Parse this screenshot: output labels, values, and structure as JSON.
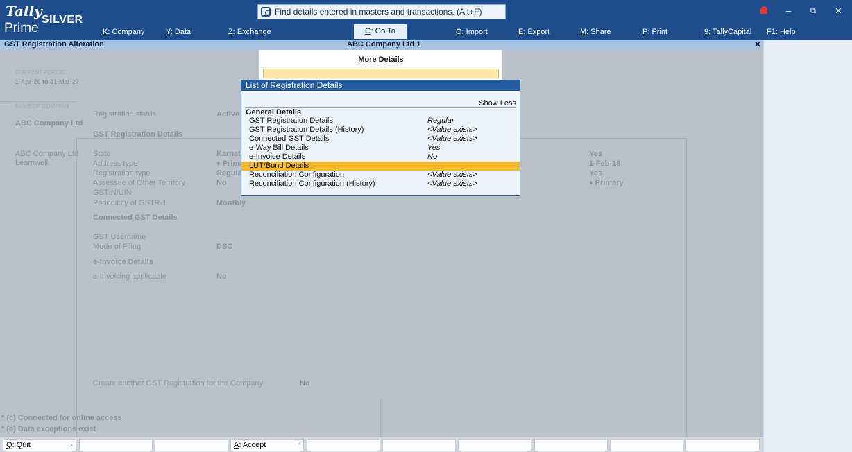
{
  "app": {
    "logo_top": "Tally",
    "logo_edition": "SILVER",
    "logo_bottom": "Prime"
  },
  "search": {
    "text": "Find details entered in masters and transactions. (Alt+F)"
  },
  "menu": [
    {
      "key": "K",
      "label": ": Company"
    },
    {
      "key": "Y",
      "label": ": Data"
    },
    {
      "key": "Z",
      "label": ": Exchange"
    },
    {
      "key": "G",
      "label": ": Go To"
    },
    {
      "key": "O",
      "label": ": Import"
    },
    {
      "key": "E",
      "label": ": Export"
    },
    {
      "key": "M",
      "label": ": Share"
    },
    {
      "key": "P",
      "label": ": Print"
    },
    {
      "key": "9",
      "label": ": TallyCapital"
    },
    {
      "key": "F1",
      "label": ": Help"
    }
  ],
  "window_controls": {
    "minimize": "–",
    "restore": "⧉",
    "close": "✕"
  },
  "subbar": {
    "left": "GST Registration Alteration",
    "center": "ABC Company Ltd 1",
    "close": "✕"
  },
  "side": {
    "current_period_label": "CURRENT PERIOD",
    "current_period": "1-Apr-26 to 31-Mar-27",
    "name_label": "NAME OF COMPANY",
    "company": "ABC Company Ltd",
    "company_line1": "ABC Company Ltd",
    "company_line2": "Learnwell"
  },
  "form": {
    "registration_status_label": "Registration status",
    "registration_status_value": "Active",
    "gst_reg_details_heading": "GST Registration Details",
    "state_label": "State",
    "state_value": "Karnata",
    "address_type_label": "Address type",
    "address_type_value": "♦ Prima",
    "registration_type_label": "Registration type",
    "registration_type_value": "Regula",
    "assessee_label": "Assessee of Other Territory",
    "assessee_value": "No",
    "gstin_label": "GSTIN/UIN",
    "periodicity_label": "Periodicity of GSTR-1",
    "periodicity_value": "Monthly",
    "connected_heading": "Connected GST Details",
    "gst_username_label": "GST Username",
    "mode_filing_label": "Mode of Filing",
    "mode_filing_value": "DSC",
    "einvoice_heading": "e-Invoice Details",
    "einvoicing_label": "e-Invoicing applicable",
    "einvoicing_value": "No",
    "right_yes1": "Yes",
    "right_date": "1-Feb-18",
    "right_yes2": "Yes",
    "right_primary": "♦ Primary",
    "create_another_label": "Create another GST Registration for the Company",
    "create_another_value": "No"
  },
  "more_details": {
    "title": "More Details"
  },
  "list": {
    "title": "List of Registration Details",
    "show_less": "Show Less",
    "section": "General Details",
    "items": [
      {
        "label": "GST Registration Details",
        "value": "Regular"
      },
      {
        "label": "GST Registration Details (History)",
        "value": "<Value exists>"
      },
      {
        "label": "Connected GST Details",
        "value": "<Value exists>"
      },
      {
        "label": "e-Way Bill Details",
        "value": "Yes"
      },
      {
        "label": "e-Invoice Details",
        "value": "No"
      },
      {
        "label": "LUT/Bond Details",
        "value": ""
      },
      {
        "label": "Reconciliation Configuration",
        "value": "<Value exists>"
      },
      {
        "label": "Reconciliation Configuration (History)",
        "value": "<Value exists>"
      }
    ],
    "selected_index": 5
  },
  "bottom_notes": {
    "connected": "* (c) Connected for online access",
    "exceptions": "* (e) Data exceptions exist"
  },
  "footer": {
    "quit_key": "Q",
    "quit_label": ": Quit",
    "accept_key": "A",
    "accept_label": ": Accept"
  },
  "colors": {
    "header": "#1e4d8e",
    "selected": "#f5b92e",
    "list_header": "#245a9e"
  }
}
